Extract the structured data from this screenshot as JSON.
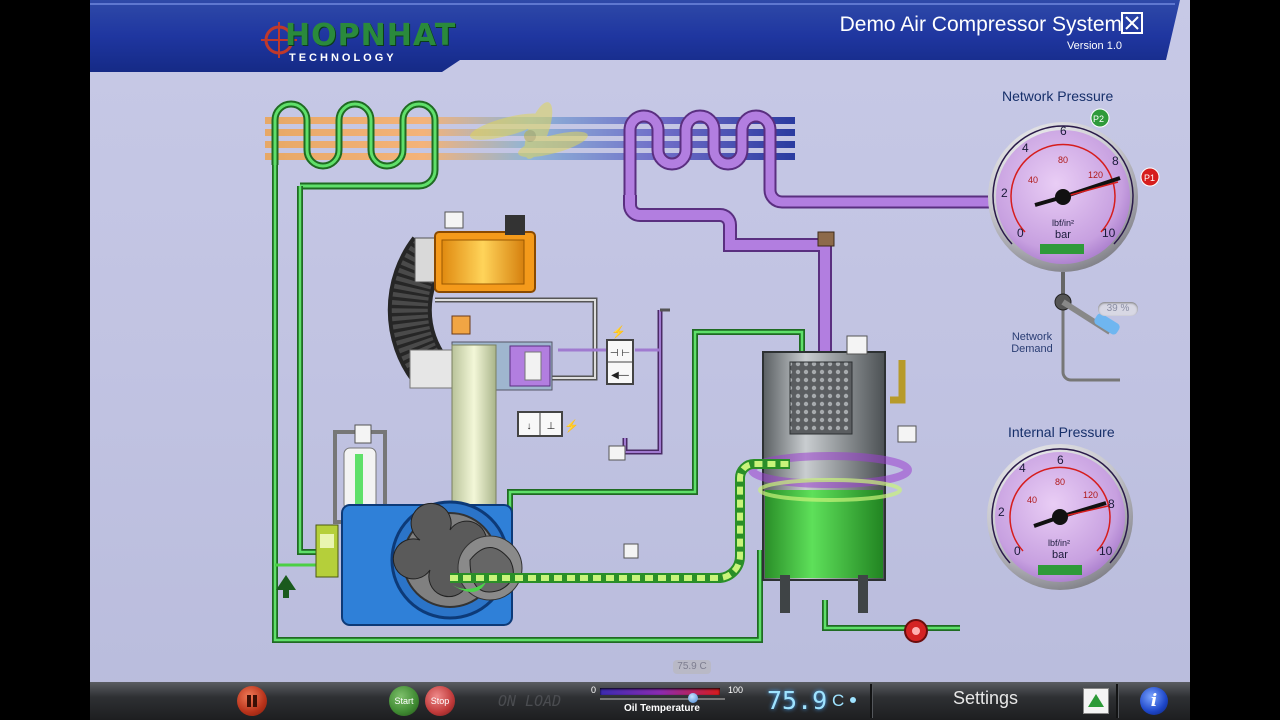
{
  "header": {
    "logo_text": "HOPNHAT",
    "logo_sub": "TECHNOLOGY",
    "title": "Demo Air Compressor System",
    "version": "Version 1.0"
  },
  "gauges": {
    "network": {
      "title": "Network Pressure",
      "unit_top": "lbf/in²",
      "unit_bottom": "bar",
      "outer_ticks": [
        "0",
        "2",
        "4",
        "6",
        "8",
        "10"
      ],
      "inner_ticks": [
        "40",
        "80",
        "120"
      ],
      "badge_p1": "P1",
      "badge_p2": "P2"
    },
    "internal": {
      "title": "Internal Pressure",
      "unit_top": "lbf/in²",
      "unit_bottom": "bar",
      "outer_ticks": [
        "0",
        "2",
        "4",
        "6",
        "8",
        "10"
      ],
      "inner_ticks": [
        "40",
        "80",
        "120"
      ]
    }
  },
  "network_demand": {
    "label_line1": "Network",
    "label_line2": "Demand",
    "percent": "39 %"
  },
  "statusbar": {
    "start_label": "Start",
    "stop_label": "Stop",
    "load_state": "ON LOAD",
    "temp_min": "0",
    "temp_max": "100",
    "temp_caption": "Oil Temperature",
    "temp_tooltip": "75.9 C",
    "temp_value": "75.9",
    "temp_unit": "C",
    "settings_label": "Settings"
  },
  "colors": {
    "oil_green": "#3fd13a",
    "air_purple": "#a86bd2",
    "hot_orange": "#f49a1b",
    "gauge_face": "#c7a0e0",
    "badge_red": "#d61d1d",
    "badge_green": "#2f9a3a"
  }
}
